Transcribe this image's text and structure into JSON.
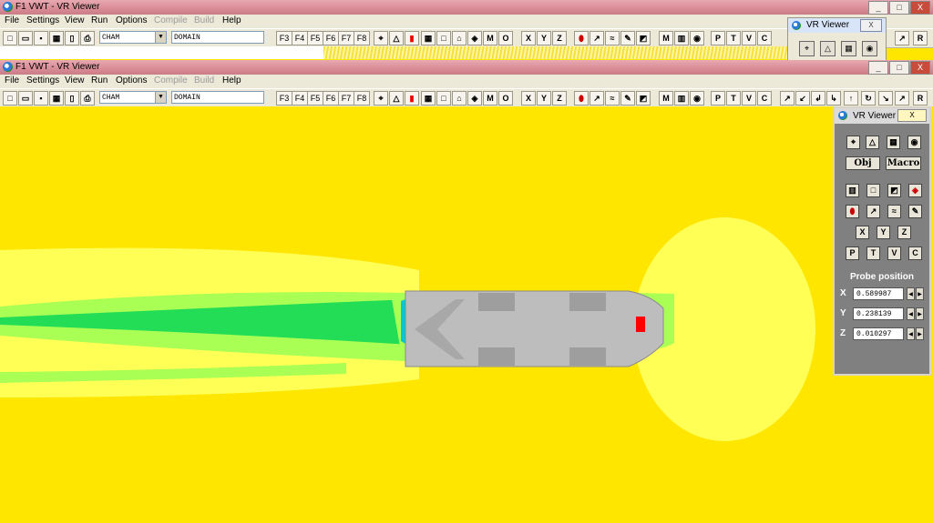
{
  "app": {
    "title": "F1 VWT - VR Viewer"
  },
  "menu": [
    "File",
    "Settings",
    "View",
    "Run",
    "Options",
    "Compile",
    "Build",
    "Help"
  ],
  "menu_disabled": [
    "Compile",
    "Build"
  ],
  "toolbar": {
    "object_combo": "CHAM",
    "domain_combo": "DOMAIN",
    "fkeys": [
      "F3",
      "F4",
      "F5",
      "F6",
      "F7",
      "F8"
    ],
    "letters": [
      "M",
      "O",
      "X",
      "Y",
      "Z"
    ],
    "letters2": [
      "M",
      "P",
      "T",
      "V",
      "C"
    ],
    "right_btn": "R"
  },
  "vr_viewer": {
    "title": "VR Viewer",
    "close_symbol": "X",
    "obj_label": "Obj",
    "macro_label": "Macro",
    "axes": [
      "X",
      "Y",
      "Z"
    ],
    "plot_buttons": [
      "P",
      "T",
      "V",
      "C"
    ],
    "probe_title": "Probe position",
    "probe": {
      "x_label": "X",
      "y_label": "Y",
      "z_label": "Z",
      "x": "0.589987",
      "y": "0.238139",
      "z": "0.010297"
    }
  },
  "window_buttons": {
    "minimize": "_",
    "maximize": "□",
    "close": "X"
  },
  "colors": {
    "background_field": "#ffe600",
    "near_field": "#ffff55",
    "wake": "#aaff55",
    "shear": "#22dd55",
    "vortex": "#00c8d8",
    "model": "#bdbdbd",
    "probe": "#ff0000",
    "panel": "#808080"
  }
}
